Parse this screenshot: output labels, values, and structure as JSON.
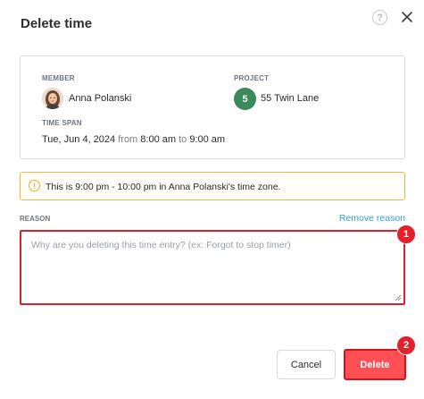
{
  "dialog": {
    "title": "Delete time",
    "help_icon": "question-circle-icon",
    "close_icon": "close-icon"
  },
  "member": {
    "label": "MEMBER",
    "name": "Anna Polanski"
  },
  "project": {
    "label": "PROJECT",
    "badge": "5",
    "badge_color": "#3a8a5c",
    "name": "55 Twin Lane"
  },
  "time_span": {
    "label": "TIME SPAN",
    "date": "Tue, Jun 4, 2024",
    "from_word": "from",
    "start": "8:00 am",
    "to_word": "to",
    "end": "9:00 am"
  },
  "timezone_notice": {
    "icon": "warning-circle-icon",
    "text": "This is 9:00 pm - 10:00 pm in Anna Polanski's time zone."
  },
  "reason": {
    "label": "REASON",
    "remove_label": "Remove reason",
    "value": "",
    "placeholder": "Why are you deleting this time entry? (ex: Forgot to stop timer)"
  },
  "markers": {
    "first": "1",
    "second": "2"
  },
  "footer": {
    "cancel_label": "Cancel",
    "delete_label": "Delete"
  },
  "colors": {
    "accent_link": "#2f9fd8",
    "danger": "#ff4f55",
    "warning_border": "#f0b545",
    "highlight_border": "#d6232d"
  }
}
